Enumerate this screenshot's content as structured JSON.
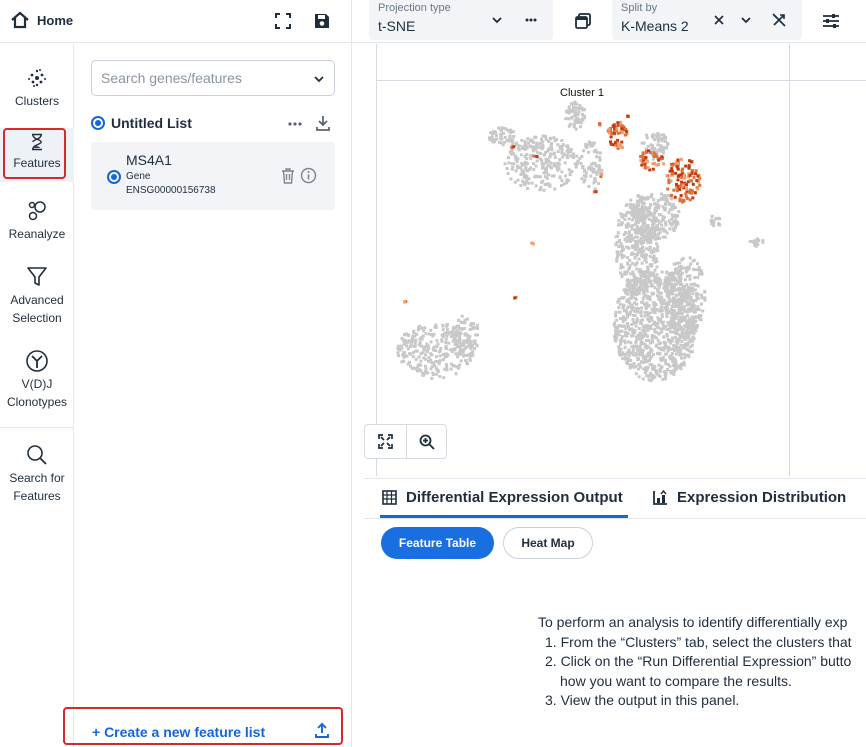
{
  "topbar": {
    "home_label": "Home",
    "projection": {
      "label": "Projection type",
      "value": "t-SNE"
    },
    "split": {
      "label": "Split by",
      "value": "K-Means 2"
    }
  },
  "nav": {
    "items": [
      {
        "label": "Clusters",
        "icon": "clusters-icon"
      },
      {
        "label": "Features",
        "icon": "hourglass-icon",
        "active": true
      },
      {
        "label": "Reanalyze",
        "icon": "bubbles-icon"
      },
      {
        "label": "Advanced Selection",
        "lines": [
          "Advanced",
          "Selection"
        ],
        "icon": "filter-icon"
      },
      {
        "label": "V(D)J Clonotypes",
        "lines": [
          "V(D)J",
          "Clonotypes"
        ],
        "icon": "antibody-icon"
      },
      {
        "label": "Search for Features",
        "lines": [
          "Search for",
          "Features"
        ],
        "icon": "search-icon"
      }
    ]
  },
  "feature_panel": {
    "search_placeholder": "Search genes/features",
    "list_name": "Untitled List",
    "feature": {
      "name": "MS4A1",
      "type": "Gene",
      "id": "ENSG00000156738"
    },
    "create_label": "+ Create a new feature list"
  },
  "plot": {
    "cluster_label": "Cluster 1",
    "colors": {
      "base": "#c8c8c8",
      "high": "#c43a0e",
      "mid": "#e0703a",
      "low": "#f0a070"
    }
  },
  "bottom": {
    "tabs": [
      "Differential Expression Output",
      "Expression Distribution"
    ],
    "pills": [
      "Feature Table",
      "Heat Map"
    ],
    "instructions": [
      "To perform an analysis to identify differentially exp",
      "1. From the “Clusters” tab, select the clusters that",
      "2. Click on the “Run Differential Expression” butto",
      "how you want to compare the results.",
      "3. View the output in this panel."
    ]
  },
  "colors": {
    "accent": "#1565d8",
    "highlight_border": "#d42a2a",
    "panel_bg": "#f2f4f7"
  }
}
